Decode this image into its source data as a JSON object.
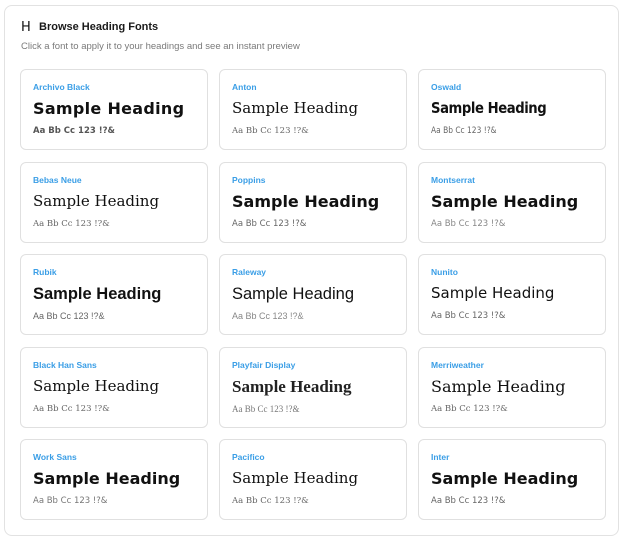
{
  "panel": {
    "title": "Browse Heading Fonts",
    "subtitle": "Click a font to apply it to your headings and see an instant preview",
    "icon": "heading-icon",
    "icon_glyph": "H"
  },
  "colors": {
    "accent": "#3a9ee6",
    "border": "#e0e0e0",
    "text": "#111111",
    "muted": "#7a7a7a"
  },
  "fonts": [
    {
      "name": "Archivo Black",
      "sample": "Sample Heading",
      "chars": "Aa Bb Cc 123 !?&"
    },
    {
      "name": "Anton",
      "sample": "Sample Heading",
      "chars": "Aa Bb Cc 123 !?&"
    },
    {
      "name": "Oswald",
      "sample": "Sample Heading",
      "chars": "Aa Bb Cc 123 !?&"
    },
    {
      "name": "Bebas Neue",
      "sample": "Sample Heading",
      "chars": "Aa Bb Cc 123 !?&"
    },
    {
      "name": "Poppins",
      "sample": "Sample Heading",
      "chars": "Aa Bb Cc 123 !?&"
    },
    {
      "name": "Montserrat",
      "sample": "Sample Heading",
      "chars": "Aa Bb Cc 123 !?&"
    },
    {
      "name": "Rubik",
      "sample": "Sample Heading",
      "chars": "Aa Bb Cc 123 !?&"
    },
    {
      "name": "Raleway",
      "sample": "Sample Heading",
      "chars": "Aa Bb Cc 123 !?&"
    },
    {
      "name": "Nunito",
      "sample": "Sample Heading",
      "chars": "Aa Bb Cc 123 !?&"
    },
    {
      "name": "Black Han Sans",
      "sample": "Sample Heading",
      "chars": "Aa Bb Cc 123 !?&"
    },
    {
      "name": "Playfair Display",
      "sample": "Sample Heading",
      "chars": "Aa Bb Cc 123 !?&"
    },
    {
      "name": "Merriweather",
      "sample": "Sample Heading",
      "chars": "Aa Bb Cc 123 !?&"
    },
    {
      "name": "Work Sans",
      "sample": "Sample Heading",
      "chars": "Aa Bb Cc 123 !?&"
    },
    {
      "name": "Pacifico",
      "sample": "Sample Heading",
      "chars": "Aa Bb Cc 123 !?&"
    },
    {
      "name": "Inter",
      "sample": "Sample Heading",
      "chars": "Aa Bb Cc 123 !?&"
    }
  ]
}
